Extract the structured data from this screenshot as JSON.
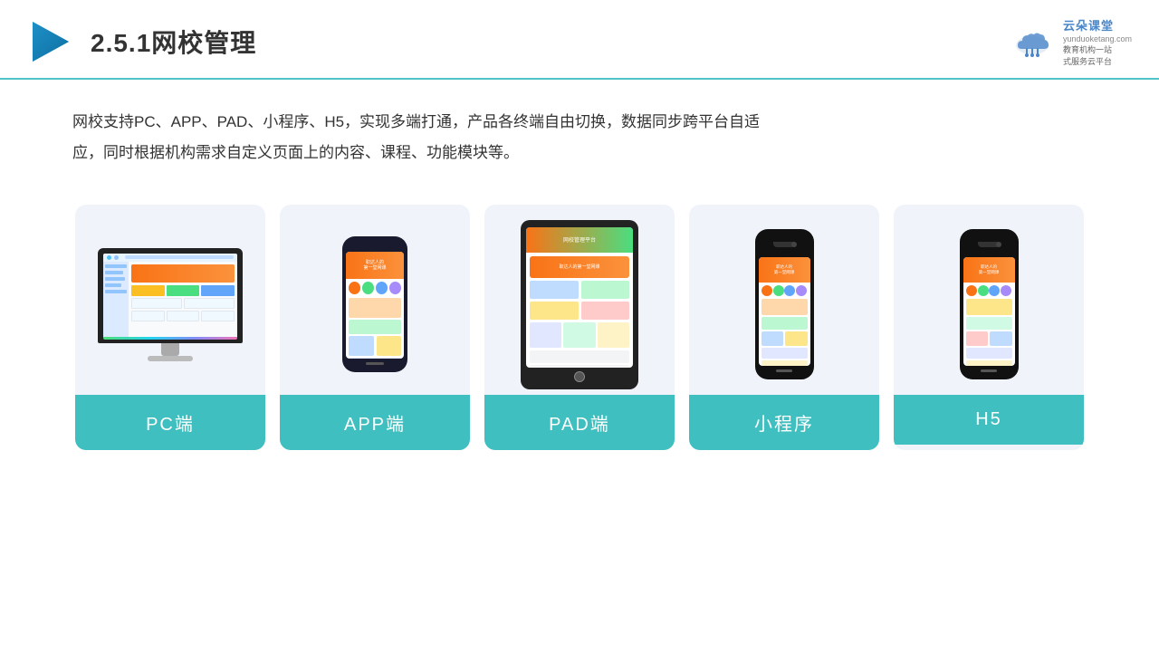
{
  "header": {
    "title": "2.5.1网校管理",
    "brand_name": "yunduoketang.com",
    "brand_slogan_line1": "教育机构一站",
    "brand_slogan_line2": "式服务云平台"
  },
  "description": {
    "text": "网校支持PC、APP、PAD、小程序、H5，实现多端打通，产品各终端自由切换，数据同步跨平台自适应，同时根据机构需求自定义页面上的内容、课程、功能模块等。"
  },
  "cards": [
    {
      "id": "pc",
      "label": "PC端"
    },
    {
      "id": "app",
      "label": "APP端"
    },
    {
      "id": "pad",
      "label": "PAD端"
    },
    {
      "id": "miniprogram",
      "label": "小程序"
    },
    {
      "id": "h5",
      "label": "H5"
    }
  ],
  "colors": {
    "teal": "#3fbfbf",
    "accent_blue": "#4a86c8",
    "header_border": "#4fc3c8",
    "text_dark": "#333333",
    "card_bg": "#eef2fa"
  }
}
